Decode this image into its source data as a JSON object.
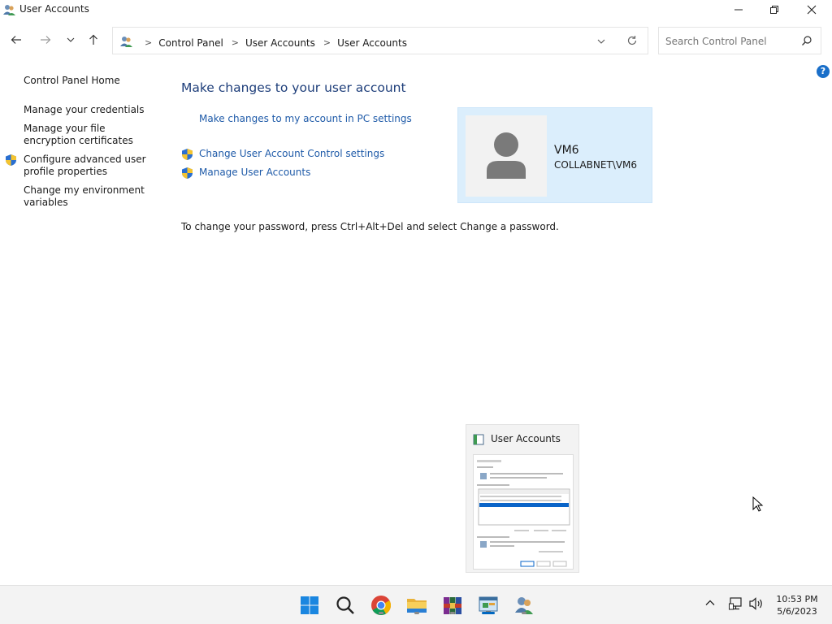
{
  "window": {
    "title": "User Accounts"
  },
  "address": {
    "crumbs": [
      "Control Panel",
      "User Accounts",
      "User Accounts"
    ]
  },
  "search": {
    "placeholder": "Search Control Panel"
  },
  "help": {
    "label": "?"
  },
  "sidebar": {
    "items": [
      {
        "label": "Control Panel Home"
      },
      {
        "label": "Manage your credentials"
      },
      {
        "label": "Manage your file encryption certificates"
      },
      {
        "label": "Configure advanced user profile properties"
      },
      {
        "label": "Change my environment variables"
      }
    ]
  },
  "main": {
    "title": "Make changes to your user account",
    "links": [
      {
        "label": "Make changes to my account in PC settings"
      },
      {
        "label": "Change User Account Control settings"
      },
      {
        "label": "Manage User Accounts"
      }
    ],
    "password_note": "To change your password, press Ctrl+Alt+Del and select Change a password."
  },
  "account": {
    "name": "VM6",
    "domain": "COLLABNET\\VM6"
  },
  "thumbnail": {
    "title": "User Accounts"
  },
  "taskbar": {
    "apps": [
      "start-icon",
      "search-icon",
      "chrome-icon",
      "file-explorer-icon",
      "winrar-icon",
      "control-panel-icon",
      "user-accounts-icon"
    ]
  },
  "clock": {
    "time": "10:53 PM",
    "date": "5/6/2023"
  },
  "colors": {
    "accent": "#0067c0",
    "link": "#1e5aa8",
    "heading": "#1e3e7a",
    "card": "#dbeefc"
  }
}
